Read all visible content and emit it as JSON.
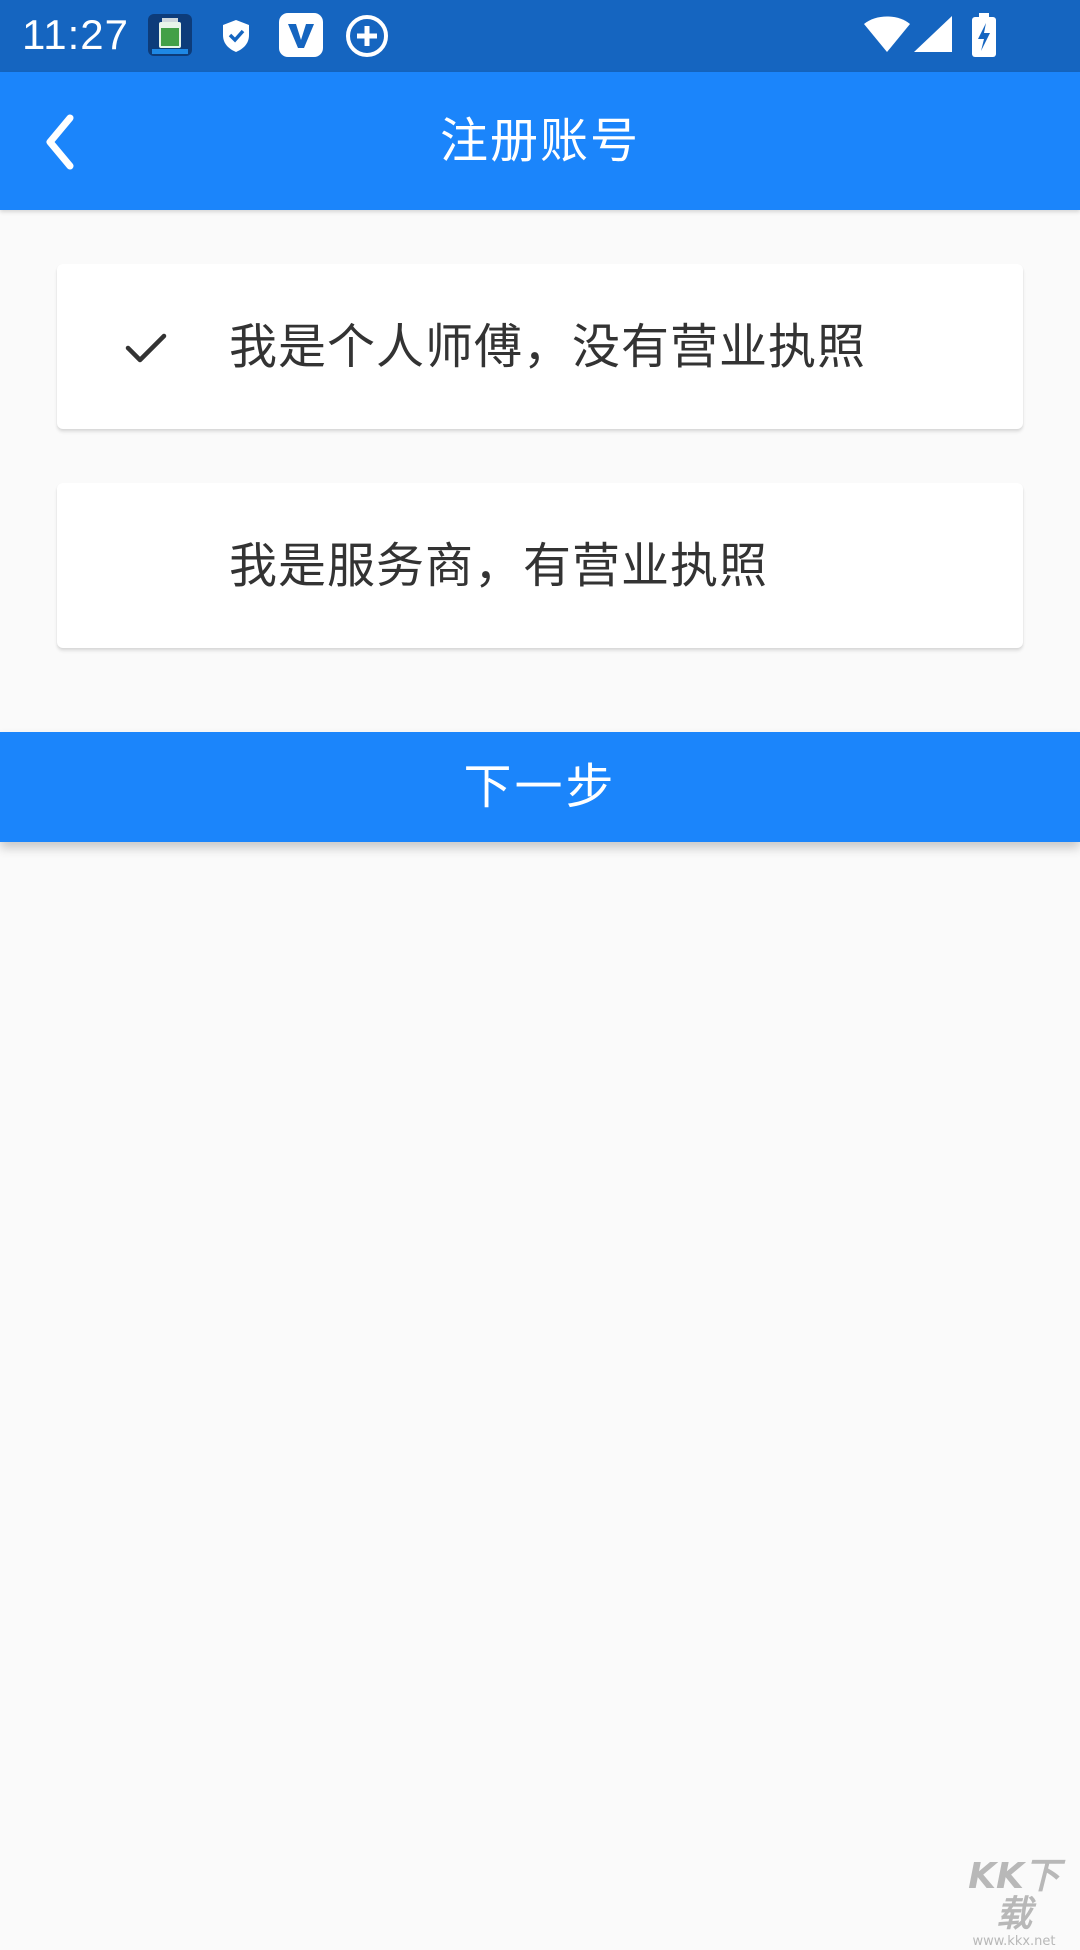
{
  "status_bar": {
    "time": "11:27",
    "icons": [
      "battery-app-icon",
      "shield-icon",
      "v-app-icon",
      "plus-circle-icon",
      "wifi-icon",
      "cellular-signal-icon",
      "battery-charging-icon"
    ]
  },
  "app_bar": {
    "title": "注册账号",
    "back_icon": "chevron-left-icon"
  },
  "options": [
    {
      "label": "我是个人师傅，没有营业执照",
      "selected": true
    },
    {
      "label": "我是服务商，有营业执照",
      "selected": false
    }
  ],
  "next_button": {
    "label": "下一步"
  },
  "colors": {
    "status_bar": "#1565c0",
    "primary": "#1b85fb",
    "background": "#fafafa",
    "card": "#ffffff",
    "text": "#333333"
  },
  "watermark": {
    "logo": "KK下载",
    "url": "www.kkx.net"
  }
}
